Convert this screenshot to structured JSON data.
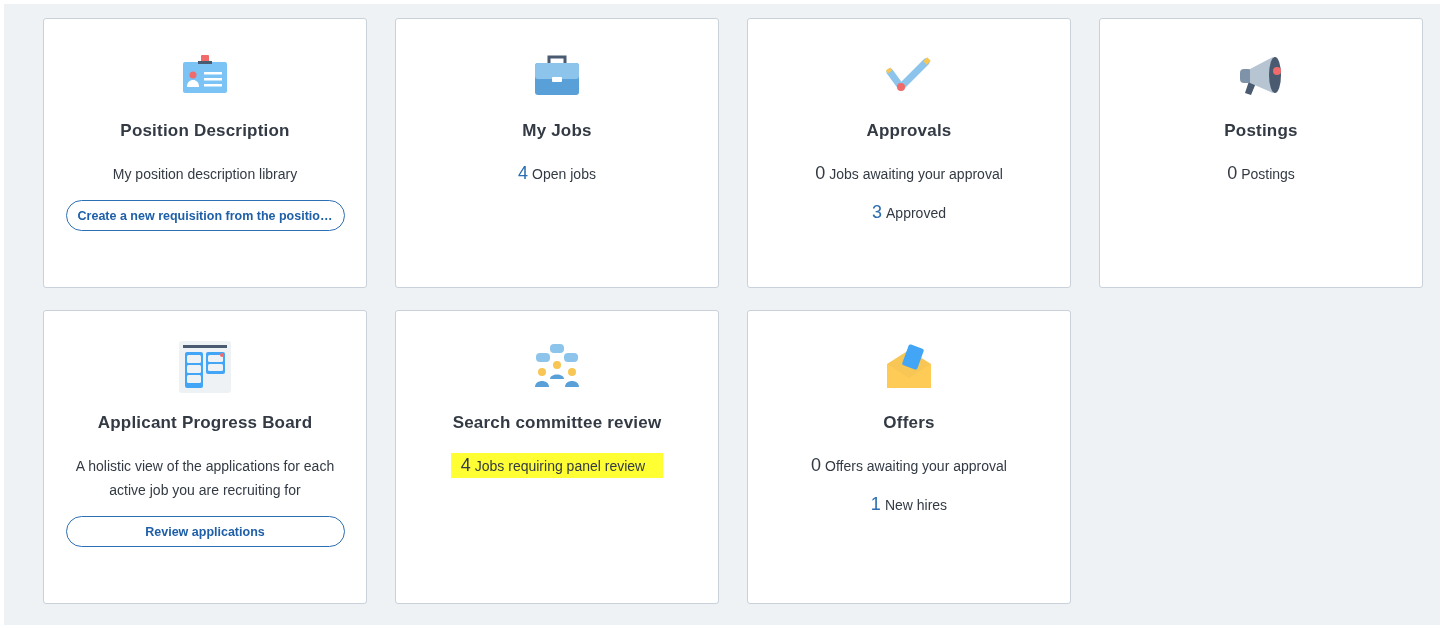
{
  "cards": [
    {
      "kind": "id-card",
      "title": "Position Description",
      "description": "My position description library",
      "button": "Create a new requisition from the positio…"
    },
    {
      "kind": "briefcase",
      "title": "My Jobs",
      "stats": [
        {
          "count": "4",
          "label": "Open jobs",
          "link": true,
          "highlighted": false
        }
      ]
    },
    {
      "kind": "pencil-check",
      "title": "Approvals",
      "stats": [
        {
          "count": "0",
          "label": "Jobs awaiting your approval",
          "link": false,
          "highlighted": false
        },
        {
          "count": "3",
          "label": "Approved",
          "link": true,
          "highlighted": false
        }
      ]
    },
    {
      "kind": "megaphone",
      "title": "Postings",
      "stats": [
        {
          "count": "0",
          "label": "Postings",
          "link": false,
          "highlighted": false
        }
      ]
    },
    {
      "kind": "board",
      "title": "Applicant Progress Board",
      "description": "A holistic view of the applications for each active job you are recruiting for",
      "button": "Review applications"
    },
    {
      "kind": "people",
      "title": "Search committee review",
      "stats": [
        {
          "count": "4",
          "label": "Jobs requiring panel review",
          "link": false,
          "highlighted": true
        }
      ]
    },
    {
      "kind": "envelope",
      "title": "Offers",
      "stats": [
        {
          "count": "0",
          "label": "Offers awaiting your approval",
          "link": false,
          "highlighted": false
        },
        {
          "count": "1",
          "label": "New hires",
          "link": true,
          "highlighted": false
        }
      ]
    }
  ]
}
